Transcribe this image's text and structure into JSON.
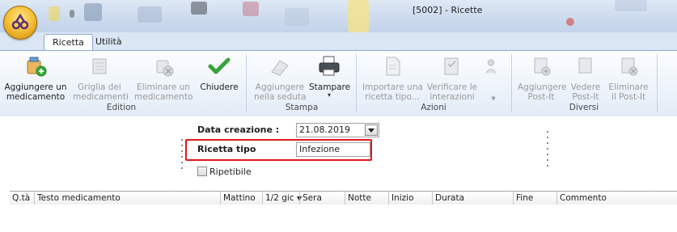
{
  "window": {
    "title": "[5002] - Ricette"
  },
  "tabs": [
    {
      "label": "Ricetta",
      "active": true
    },
    {
      "label": "Utilità",
      "active": false
    }
  ],
  "ribbon": {
    "groups": [
      {
        "label": "Edition",
        "buttons": [
          {
            "label": "Aggiungere un\nmedicamento",
            "enabled": true,
            "icon": "add-medication-icon"
          },
          {
            "label": "Griglia dei\nmedicamenti",
            "enabled": false,
            "icon": "medication-grid-icon"
          },
          {
            "label": "Eliminare un\nmedicamento",
            "enabled": false,
            "icon": "delete-medication-icon"
          },
          {
            "label": "Chiudere",
            "enabled": true,
            "icon": "checkmark-icon"
          }
        ]
      },
      {
        "label": "Stampa",
        "buttons": [
          {
            "label": "Aggiungere\nnella seduta",
            "enabled": false,
            "icon": "add-to-session-icon"
          },
          {
            "label": "Stampare",
            "enabled": true,
            "icon": "printer-icon",
            "dropdown": true
          }
        ]
      },
      {
        "label": "Azioni",
        "buttons": [
          {
            "label": "Importare una\nricetta tipo...",
            "enabled": false,
            "icon": "import-recipe-icon"
          },
          {
            "label": "Verificare le\ninterazioni",
            "enabled": false,
            "icon": "check-interactions-icon",
            "dropdown": true
          },
          {
            "label": "",
            "enabled": false,
            "icon": "person-icon",
            "dropdown": true
          }
        ]
      },
      {
        "label": "Diversi",
        "buttons": [
          {
            "label": "Aggiungere\nPost-It",
            "enabled": false,
            "icon": "add-postit-icon"
          },
          {
            "label": "Vedere\nPost-It",
            "enabled": false,
            "icon": "view-postit-icon"
          },
          {
            "label": "Eliminare\nil Post-It",
            "enabled": false,
            "icon": "delete-postit-icon"
          }
        ]
      }
    ]
  },
  "form": {
    "date_label": "Data creazione :",
    "date_value": "21.08.2019",
    "recipe_type_label": "Ricetta tipo",
    "recipe_type_value": "Infezione",
    "repeatable_label": "Ripetibile",
    "repeatable_checked": false
  },
  "grid": {
    "columns": [
      "Q.tà",
      "Testo medicamento",
      "Mattino",
      "1/2 gic",
      "Sera",
      "Notte",
      "Inizio",
      "Durata",
      "Fine",
      "Commento"
    ],
    "rows": []
  },
  "colors": {
    "highlight": "#e01818",
    "ribbon_border": "#8ea9cf",
    "checkmark": "#3aa33a"
  }
}
